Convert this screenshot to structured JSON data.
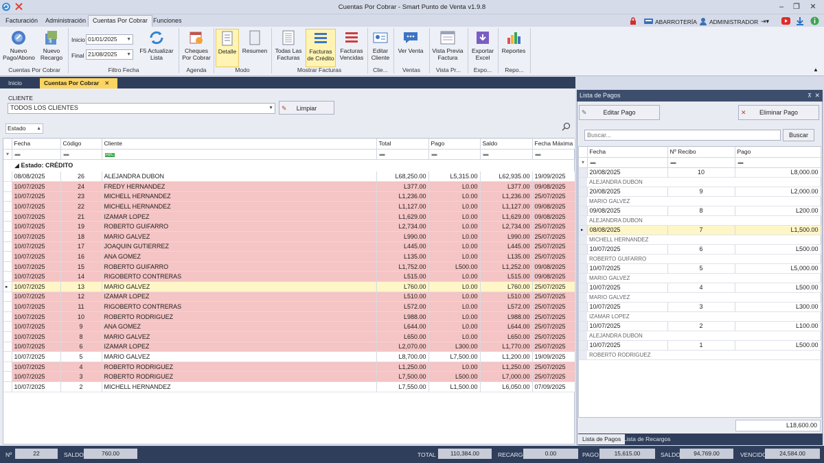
{
  "window": {
    "title": "Cuentas Por Cobrar - Smart Punto de Venta v1.9.8"
  },
  "menu": {
    "tabs": [
      "Facturación",
      "Administración",
      "Cuentas Por Cobrar",
      "Funciones"
    ]
  },
  "topright": {
    "store": "ABARROTERÍA",
    "user": "ADMINISTRADOR"
  },
  "ribbon": {
    "nuevo_pago": "Nuevo Pago/Abono",
    "nuevo_recargo": "Nuevo Recargo",
    "group_cxc": "Cuentas Por Cobrar",
    "inicio_label": "Inicio",
    "inicio_value": "01/01/2025",
    "final_label": "Final",
    "final_value": "21/08/2025",
    "actualizar": "F5 Actualizar Lista",
    "group_filtro": "Filtro Fecha",
    "cheques": "Cheques Por Cobrar",
    "group_agenda": "Agenda",
    "detalle": "Detalle",
    "resumen": "Resumen",
    "group_modo": "Modo",
    "todas": "Todas Las Facturas",
    "credito": "Facturas de Crédito",
    "vencidas": "Facturas Vencidas",
    "group_mostrar": "Mostrar Facturas",
    "editar_cliente": "Editar Cliente",
    "group_cliente": "Clie...",
    "ver_venta": "Ver Venta",
    "group_ventas": "Ventas",
    "vista_previa": "Vista Previa Factura",
    "group_vista": "Vista Pr...",
    "exportar": "Exportar Excel",
    "group_expo": "Expo...",
    "reportes": "Reportes",
    "group_repo": "Repo..."
  },
  "doc_tabs": {
    "inicio": "Inicio",
    "cxc": "Cuentas Por Cobrar"
  },
  "filter": {
    "cliente_label": "CLIENTE",
    "cliente_value": "TODOS LOS CLIENTES",
    "limpiar": "Limpiar",
    "estado": "Estado"
  },
  "grid": {
    "columns": [
      "Fecha",
      "Código",
      "Cliente",
      "Total",
      "Pago",
      "Saldo",
      "Fecha Máxima"
    ],
    "group_label": "Estado: CRÉDITO",
    "rows": [
      {
        "fecha": "08/08/2025",
        "codigo": "26",
        "cliente": "ALEJANDRA DUBON",
        "total": "L68,250.00",
        "pago": "L5,315.00",
        "saldo": "L62,935.00",
        "fmax": "19/09/2025",
        "style": "white"
      },
      {
        "fecha": "10/07/2025",
        "codigo": "24",
        "cliente": "FREDY HERNANDEZ",
        "total": "L377.00",
        "pago": "L0.00",
        "saldo": "L377.00",
        "fmax": "09/08/2025",
        "style": "red"
      },
      {
        "fecha": "10/07/2025",
        "codigo": "23",
        "cliente": "MICHELL HERNANDEZ",
        "total": "L1,236.00",
        "pago": "L0.00",
        "saldo": "L1,236.00",
        "fmax": "25/07/2025",
        "style": "red"
      },
      {
        "fecha": "10/07/2025",
        "codigo": "22",
        "cliente": "MICHELL HERNANDEZ",
        "total": "L1,127.00",
        "pago": "L0.00",
        "saldo": "L1,127.00",
        "fmax": "09/08/2025",
        "style": "red"
      },
      {
        "fecha": "10/07/2025",
        "codigo": "21",
        "cliente": "IZAMAR LOPEZ",
        "total": "L1,629.00",
        "pago": "L0.00",
        "saldo": "L1,629.00",
        "fmax": "09/08/2025",
        "style": "red"
      },
      {
        "fecha": "10/07/2025",
        "codigo": "19",
        "cliente": "ROBERTO GUIFARRO",
        "total": "L2,734.00",
        "pago": "L0.00",
        "saldo": "L2,734.00",
        "fmax": "25/07/2025",
        "style": "red"
      },
      {
        "fecha": "10/07/2025",
        "codigo": "18",
        "cliente": "MARIO GALVEZ",
        "total": "L990.00",
        "pago": "L0.00",
        "saldo": "L990.00",
        "fmax": "25/07/2025",
        "style": "red"
      },
      {
        "fecha": "10/07/2025",
        "codigo": "17",
        "cliente": "JOAQUIN GUTIERREZ",
        "total": "L445.00",
        "pago": "L0.00",
        "saldo": "L445.00",
        "fmax": "25/07/2025",
        "style": "red"
      },
      {
        "fecha": "10/07/2025",
        "codigo": "16",
        "cliente": "ANA GOMEZ",
        "total": "L135.00",
        "pago": "L0.00",
        "saldo": "L135.00",
        "fmax": "25/07/2025",
        "style": "red"
      },
      {
        "fecha": "10/07/2025",
        "codigo": "15",
        "cliente": "ROBERTO GUIFARRO",
        "total": "L1,752.00",
        "pago": "L500.00",
        "saldo": "L1,252.00",
        "fmax": "09/08/2025",
        "style": "red"
      },
      {
        "fecha": "10/07/2025",
        "codigo": "14",
        "cliente": "RIGOBERTO CONTRERAS",
        "total": "L515.00",
        "pago": "L0.00",
        "saldo": "L515.00",
        "fmax": "09/08/2025",
        "style": "red"
      },
      {
        "fecha": "10/07/2025",
        "codigo": "13",
        "cliente": "MARIO GALVEZ",
        "total": "L760.00",
        "pago": "L0.00",
        "saldo": "L760.00",
        "fmax": "25/07/2025",
        "style": "sel"
      },
      {
        "fecha": "10/07/2025",
        "codigo": "12",
        "cliente": "IZAMAR LOPEZ",
        "total": "L510.00",
        "pago": "L0.00",
        "saldo": "L510.00",
        "fmax": "25/07/2025",
        "style": "red"
      },
      {
        "fecha": "10/07/2025",
        "codigo": "11",
        "cliente": "RIGOBERTO CONTRERAS",
        "total": "L572.00",
        "pago": "L0.00",
        "saldo": "L572.00",
        "fmax": "25/07/2025",
        "style": "red"
      },
      {
        "fecha": "10/07/2025",
        "codigo": "10",
        "cliente": "ROBERTO RODRIGUEZ",
        "total": "L988.00",
        "pago": "L0.00",
        "saldo": "L988.00",
        "fmax": "25/07/2025",
        "style": "red"
      },
      {
        "fecha": "10/07/2025",
        "codigo": "9",
        "cliente": "ANA GOMEZ",
        "total": "L644.00",
        "pago": "L0.00",
        "saldo": "L644.00",
        "fmax": "25/07/2025",
        "style": "red"
      },
      {
        "fecha": "10/07/2025",
        "codigo": "8",
        "cliente": "MARIO GALVEZ",
        "total": "L650.00",
        "pago": "L0.00",
        "saldo": "L650.00",
        "fmax": "25/07/2025",
        "style": "red"
      },
      {
        "fecha": "10/07/2025",
        "codigo": "6",
        "cliente": "IZAMAR LOPEZ",
        "total": "L2,070.00",
        "pago": "L300.00",
        "saldo": "L1,770.00",
        "fmax": "25/07/2025",
        "style": "red"
      },
      {
        "fecha": "10/07/2025",
        "codigo": "5",
        "cliente": "MARIO GALVEZ",
        "total": "L8,700.00",
        "pago": "L7,500.00",
        "saldo": "L1,200.00",
        "fmax": "19/09/2025",
        "style": "white"
      },
      {
        "fecha": "10/07/2025",
        "codigo": "4",
        "cliente": "ROBERTO RODRIGUEZ",
        "total": "L1,250.00",
        "pago": "L0.00",
        "saldo": "L1,250.00",
        "fmax": "25/07/2025",
        "style": "red"
      },
      {
        "fecha": "10/07/2025",
        "codigo": "3",
        "cliente": "ROBERTO RODRIGUEZ",
        "total": "L7,500.00",
        "pago": "L500.00",
        "saldo": "L7,000.00",
        "fmax": "25/07/2025",
        "style": "red"
      },
      {
        "fecha": "10/07/2025",
        "codigo": "2",
        "cliente": "MICHELL HERNANDEZ",
        "total": "L7,550.00",
        "pago": "L1,500.00",
        "saldo": "L6,050.00",
        "fmax": "07/09/2025",
        "style": "white"
      }
    ]
  },
  "payments": {
    "title": "Lista de Pagos",
    "editar": "Editar Pago",
    "eliminar": "Eliminar Pago",
    "search_placeholder": "Buscar...",
    "buscar": "Buscar",
    "columns": [
      "Fecha",
      "Nº Recibo",
      "Pago"
    ],
    "rows": [
      {
        "fecha": "20/08/2025",
        "recibo": "10",
        "pago": "L8,000.00",
        "cliente": "ALEJANDRA DUBON",
        "sel": false
      },
      {
        "fecha": "20/08/2025",
        "recibo": "9",
        "pago": "L2,000.00",
        "cliente": "MARIO GALVEZ",
        "sel": false
      },
      {
        "fecha": "09/08/2025",
        "recibo": "8",
        "pago": "L200.00",
        "cliente": "ALEJANDRA DUBON",
        "sel": false
      },
      {
        "fecha": "08/08/2025",
        "recibo": "7",
        "pago": "L1,500.00",
        "cliente": "MICHELL HERNANDEZ",
        "sel": true
      },
      {
        "fecha": "10/07/2025",
        "recibo": "6",
        "pago": "L500.00",
        "cliente": "ROBERTO GUIFARRO",
        "sel": false
      },
      {
        "fecha": "10/07/2025",
        "recibo": "5",
        "pago": "L5,000.00",
        "cliente": "MARIO GALVEZ",
        "sel": false
      },
      {
        "fecha": "10/07/2025",
        "recibo": "4",
        "pago": "L500.00",
        "cliente": "MARIO GALVEZ",
        "sel": false
      },
      {
        "fecha": "10/07/2025",
        "recibo": "3",
        "pago": "L300.00",
        "cliente": "IZAMAR LOPEZ",
        "sel": false
      },
      {
        "fecha": "10/07/2025",
        "recibo": "2",
        "pago": "L100.00",
        "cliente": "ALEJANDRA DUBON",
        "sel": false
      },
      {
        "fecha": "10/07/2025",
        "recibo": "1",
        "pago": "L500.00",
        "cliente": "ROBERTO RODRIGUEZ",
        "sel": false
      }
    ],
    "total": "L18,600.00",
    "tab_pagos": "Lista de Pagos",
    "tab_recargos": "Lista de Recargos"
  },
  "status": {
    "n_label": "Nº",
    "n_value": "22",
    "saldo_label": "SALDO",
    "saldo_value": "760.00",
    "total_label": "TOTAL",
    "total_value": "110,384.00",
    "recargo_label": "RECARGO",
    "recargo_value": "0.00",
    "pago_label": "PAGO",
    "pago_value": "15,615.00",
    "saldo2_label": "SALDO",
    "saldo2_value": "94,769.00",
    "vencido_label": "VENCIDO",
    "vencido_value": "24,584.00"
  },
  "colors": {
    "accent": "#fcd560",
    "overdue": "#f5c4c4",
    "selected": "#fff6c8",
    "dark": "#2f3e5b"
  }
}
